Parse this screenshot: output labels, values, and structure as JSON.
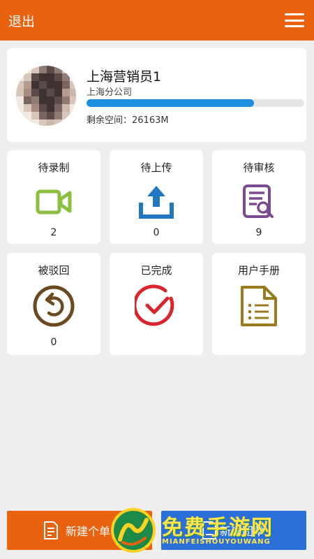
{
  "header": {
    "logout_label": "退出",
    "menu_icon": "hamburger-menu-icon"
  },
  "profile": {
    "name": "上海营销员1",
    "company": "上海分公司",
    "storage_label": "剩余空间：26163M",
    "storage_fraction": 0.77
  },
  "tiles": [
    {
      "label": "待录制",
      "icon": "video-camera-icon",
      "count": "2",
      "color": "#8bbf3f"
    },
    {
      "label": "待上传",
      "icon": "upload-icon",
      "count": "0",
      "color": "#1f78c1"
    },
    {
      "label": "待审核",
      "icon": "document-search-icon",
      "count": "9",
      "color": "#7a4b8f"
    },
    {
      "label": "被驳回",
      "icon": "undo-circle-icon",
      "count": "0",
      "color": "#6b4a1f"
    },
    {
      "label": "已完成",
      "icon": "check-circle-icon",
      "count": "",
      "color": "#d9262c"
    },
    {
      "label": "用户手册",
      "icon": "document-list-icon",
      "count": "",
      "color": "#9a7a1f"
    }
  ],
  "bottom": {
    "new_single_label": "新建个单",
    "new_group_label": "新建团单"
  },
  "watermark": {
    "title": "免费手游网",
    "subtitle": "MIANFEISHOUYOUWANG"
  },
  "colors": {
    "brand_orange": "#e8620f",
    "progress_blue": "#1d8fe0",
    "group_button_blue": "#2b6fd9"
  }
}
